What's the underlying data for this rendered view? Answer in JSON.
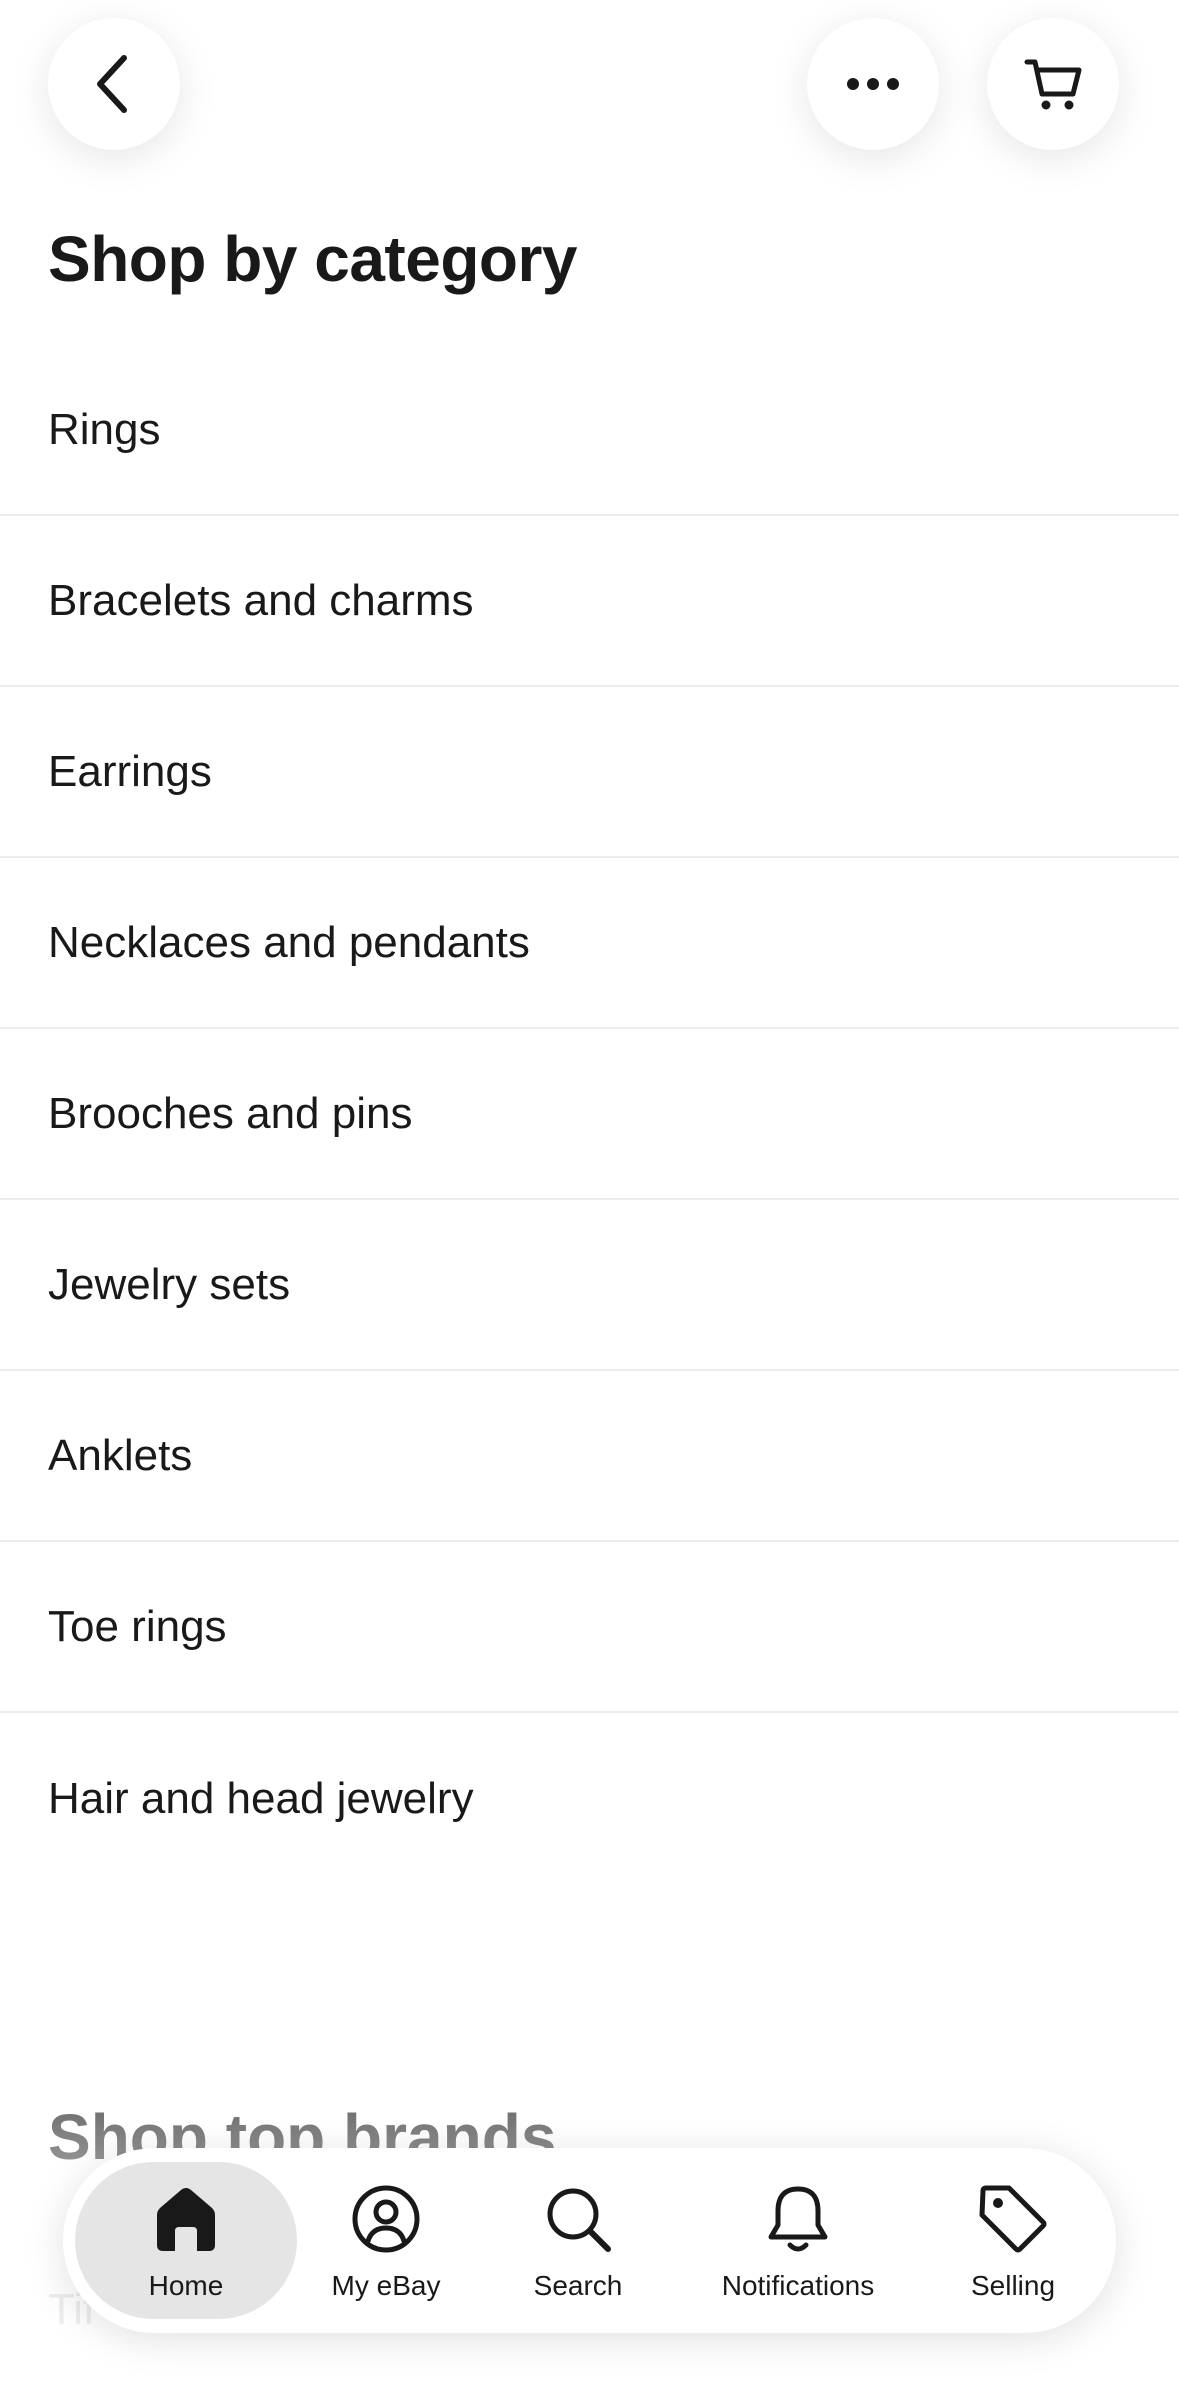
{
  "header": {
    "back_icon": "chevron-left-icon",
    "more_icon": "more-horizontal-icon",
    "cart_icon": "cart-icon"
  },
  "page_title": "Shop by category",
  "categories": [
    {
      "label": "Rings"
    },
    {
      "label": "Bracelets and charms"
    },
    {
      "label": "Earrings"
    },
    {
      "label": "Necklaces and pendants"
    },
    {
      "label": "Brooches and pins"
    },
    {
      "label": "Jewelry sets"
    },
    {
      "label": "Anklets"
    },
    {
      "label": "Toe rings"
    },
    {
      "label": "Hair and head jewelry"
    }
  ],
  "next_section": {
    "title": "Shop top brands",
    "partial_text": "Tif"
  },
  "bottom_nav": {
    "items": [
      {
        "label": "Home",
        "icon": "home-icon",
        "selected": true
      },
      {
        "label": "My eBay",
        "icon": "user-circle-icon"
      },
      {
        "label": "Search",
        "icon": "search-icon"
      },
      {
        "label": "Notifications",
        "icon": "bell-icon"
      },
      {
        "label": "Selling",
        "icon": "tag-icon"
      }
    ]
  },
  "colors": {
    "text": "#191919",
    "divider": "#ececec",
    "selected_nav_bg": "#e5e5e5",
    "faded_text": "#c7c7c7"
  }
}
